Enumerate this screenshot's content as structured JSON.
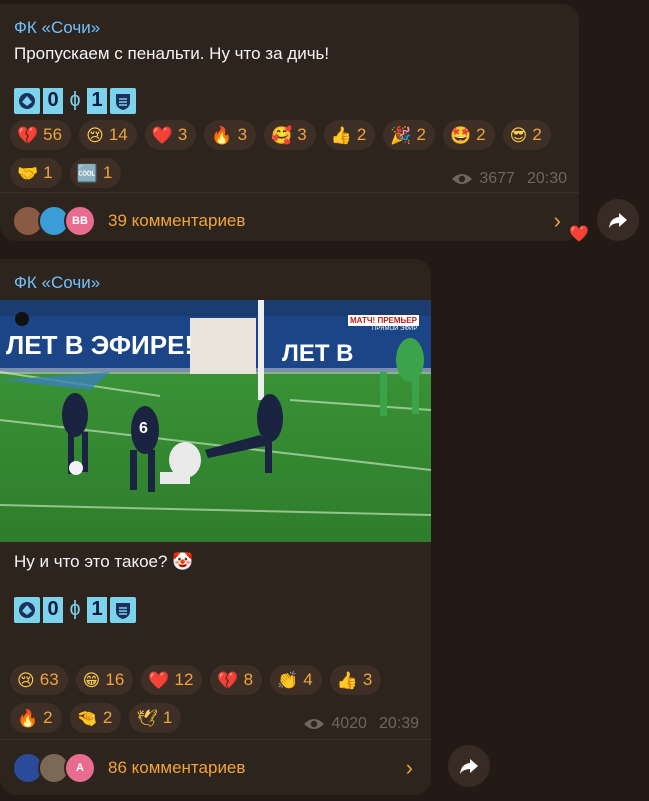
{
  "post1": {
    "channel": "ФК «Сочи»",
    "text": "Пропускаем с пенальти. Ну что за дичь!",
    "score": {
      "home": "0",
      "sep": "ɸ",
      "away": "1"
    },
    "reactions": [
      {
        "emoji": "💔",
        "count": "56"
      },
      {
        "emoji": "😢",
        "count": "14"
      },
      {
        "emoji": "❤️",
        "count": "3"
      },
      {
        "emoji": "🔥",
        "count": "3"
      },
      {
        "emoji": "🥰",
        "count": "3"
      },
      {
        "emoji": "👍",
        "count": "2"
      },
      {
        "emoji": "🎉",
        "count": "2"
      },
      {
        "emoji": "🤩",
        "count": "2"
      },
      {
        "emoji": "😎",
        "count": "2"
      },
      {
        "emoji": "🤝",
        "count": "1"
      },
      {
        "emoji": "🆒",
        "count": "1"
      }
    ],
    "views": "3677",
    "time": "20:30",
    "comments": "39 комментариев",
    "avatar_initials": "BB",
    "own_reaction": "❤️"
  },
  "post2": {
    "channel": "ФК «Сочи»",
    "video_banner_1": "ЛЕТ В ЭФИРЕ!",
    "video_banner_2": "ЛЕТ В",
    "video_badge": "МАТЧ! ПРЕМЬЕР",
    "video_badge_sub": "ПРЯМОЙ ЭФИР",
    "player_number": "6",
    "text": "Ну и что это такое? 🤡",
    "score": {
      "home": "0",
      "sep": "ɸ",
      "away": "1"
    },
    "reactions": [
      {
        "emoji": "😢",
        "count": "63"
      },
      {
        "emoji": "😁",
        "count": "16"
      },
      {
        "emoji": "❤️",
        "count": "12"
      },
      {
        "emoji": "💔",
        "count": "8"
      },
      {
        "emoji": "👏",
        "count": "4"
      },
      {
        "emoji": "👍",
        "count": "3"
      },
      {
        "emoji": "🔥",
        "count": "2"
      },
      {
        "emoji": "🤏",
        "count": "2"
      },
      {
        "emoji": "🕊",
        "count": "1"
      }
    ],
    "views": "4020",
    "time": "20:39",
    "comments": "86 комментариев",
    "avatar_initials": "A"
  },
  "colors": {
    "accent": "#f0a43a",
    "link": "#6fc1ff",
    "bubble": "#2e241e",
    "background": "#231a15"
  }
}
